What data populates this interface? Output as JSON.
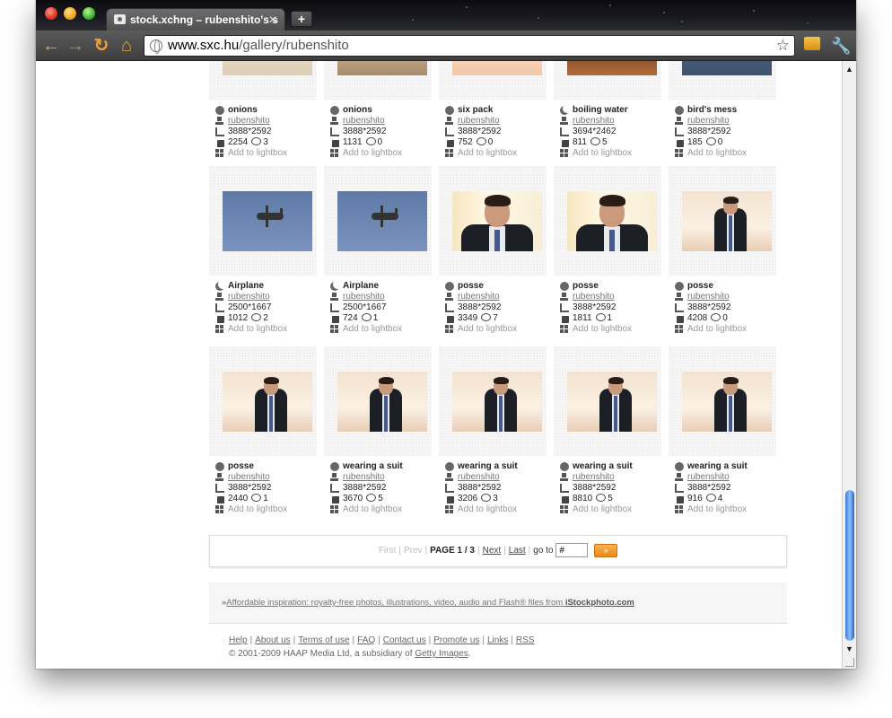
{
  "browser": {
    "tab_title": "stock.xchng – rubenshito's s",
    "tab_close": "✕",
    "new_tab": "+",
    "url_host": "www.sxc.hu",
    "url_path": "/gallery/rubenshito",
    "star": "☆"
  },
  "gallery": {
    "add_label": "Add to lightbox",
    "items": [
      {
        "title": "onions",
        "user": "rubenshito",
        "size": "3888*2592",
        "downloads": "2254",
        "comments": "3",
        "icon": "camera-icon",
        "photo": "onion-top"
      },
      {
        "title": "onions",
        "user": "rubenshito",
        "size": "3888*2592",
        "downloads": "1131",
        "comments": "0",
        "icon": "camera-icon",
        "photo": "pan-top"
      },
      {
        "title": "six pack",
        "user": "rubenshito",
        "size": "3888*2592",
        "downloads": "752",
        "comments": "0",
        "icon": "camera-icon",
        "photo": "six-top"
      },
      {
        "title": "boiling water",
        "user": "rubenshito",
        "size": "3694*2462",
        "downloads": "811",
        "comments": "5",
        "icon": "moon-icon",
        "photo": "boil-top"
      },
      {
        "title": "bird's mess",
        "user": "rubenshito",
        "size": "3888*2592",
        "downloads": "185",
        "comments": "0",
        "icon": "camera-icon",
        "photo": "bird-top"
      },
      {
        "title": "Airplane",
        "user": "rubenshito",
        "size": "2500*1667",
        "downloads": "1012",
        "comments": "2",
        "icon": "moon-icon",
        "photo": "airplane"
      },
      {
        "title": "Airplane",
        "user": "rubenshito",
        "size": "2500*1667",
        "downloads": "724",
        "comments": "1",
        "icon": "moon-icon",
        "photo": "airplane"
      },
      {
        "title": "posse",
        "user": "rubenshito",
        "size": "3888*2592",
        "downloads": "3349",
        "comments": "7",
        "icon": "camera-icon",
        "photo": "portrait"
      },
      {
        "title": "posse",
        "user": "rubenshito",
        "size": "3888*2592",
        "downloads": "1811",
        "comments": "1",
        "icon": "camera-icon",
        "photo": "portrait"
      },
      {
        "title": "posse",
        "user": "rubenshito",
        "size": "3888*2592",
        "downloads": "4208",
        "comments": "0",
        "icon": "camera-icon",
        "photo": "standing"
      },
      {
        "title": "posse",
        "user": "rubenshito",
        "size": "3888*2592",
        "downloads": "2440",
        "comments": "1",
        "icon": "camera-icon",
        "photo": "standing"
      },
      {
        "title": "wearing a suit",
        "user": "rubenshito",
        "size": "3888*2592",
        "downloads": "3670",
        "comments": "5",
        "icon": "camera-icon",
        "photo": "standing"
      },
      {
        "title": "wearing a suit",
        "user": "rubenshito",
        "size": "3888*2592",
        "downloads": "3206",
        "comments": "3",
        "icon": "camera-icon",
        "photo": "standing"
      },
      {
        "title": "wearing a suit",
        "user": "rubenshito",
        "size": "3888*2592",
        "downloads": "8810",
        "comments": "5",
        "icon": "camera-icon",
        "photo": "standing"
      },
      {
        "title": "wearing a suit",
        "user": "rubenshito",
        "size": "3888*2592",
        "downloads": "916",
        "comments": "4",
        "icon": "camera-icon",
        "photo": "standing"
      }
    ]
  },
  "pager": {
    "first": "First",
    "prev": "Prev",
    "page": "PAGE 1 / 3",
    "next": "Next",
    "last": "Last",
    "goto": "go to",
    "goto_placeholder": "#",
    "go_label": "»"
  },
  "promo": {
    "prefix": "»",
    "link": "Affordable inspiration: royalty-free photos, illustrations, video, audio and Flash® files from ",
    "brand": "iStockphoto.com"
  },
  "footer": {
    "links": [
      "Help",
      "About us",
      "Terms of use",
      "FAQ",
      "Contact us",
      "Promote us",
      "Links",
      "RSS"
    ],
    "copyright": "© 2001-2009 HAAP Media Ltd, a subsidiary of ",
    "copyright_link": "Getty Images",
    "copyright_end": "."
  }
}
